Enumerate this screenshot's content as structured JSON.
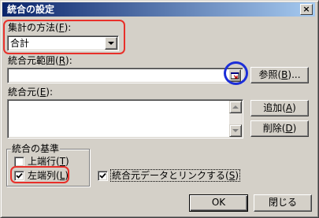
{
  "window": {
    "title": "統合の設定",
    "close_glyph": "×"
  },
  "function_group": {
    "label_text": "集計の方法(",
    "label_key": "F",
    "label_tail": "):",
    "selected_value": "合計"
  },
  "reference": {
    "label_text": "統合元範囲(",
    "label_key": "R",
    "label_tail": "):",
    "value": "",
    "collapse_icon": "range-collapse-icon"
  },
  "browse_button": {
    "text": "参照(",
    "key": "B",
    "tail": ")..."
  },
  "sources": {
    "label_text": "統合元(",
    "label_key": "E",
    "label_tail": "):",
    "items": []
  },
  "add_button": {
    "text": "追加(",
    "key": "A",
    "tail": ")"
  },
  "delete_button": {
    "text": "削除(",
    "key": "D",
    "tail": ")"
  },
  "use_labels": {
    "group_label": "統合の基準",
    "top_row": {
      "text": "上端行(",
      "key": "T",
      "tail": ")",
      "checked": false
    },
    "left_column": {
      "text": "左端列(",
      "key": "L",
      "tail": ")",
      "checked": true
    }
  },
  "link_sources": {
    "text": "統合元データとリンクする(",
    "key": "S",
    "tail": ")",
    "checked": true
  },
  "ok_button": {
    "text": "OK"
  },
  "close_button": {
    "text": "閉じる"
  },
  "colors": {
    "titlebar_start": "#0a246a",
    "titlebar_end": "#a6caf0",
    "face": "#d4d0c8",
    "annotation_red": "#e8302a",
    "annotation_blue": "#1c2ed8"
  }
}
